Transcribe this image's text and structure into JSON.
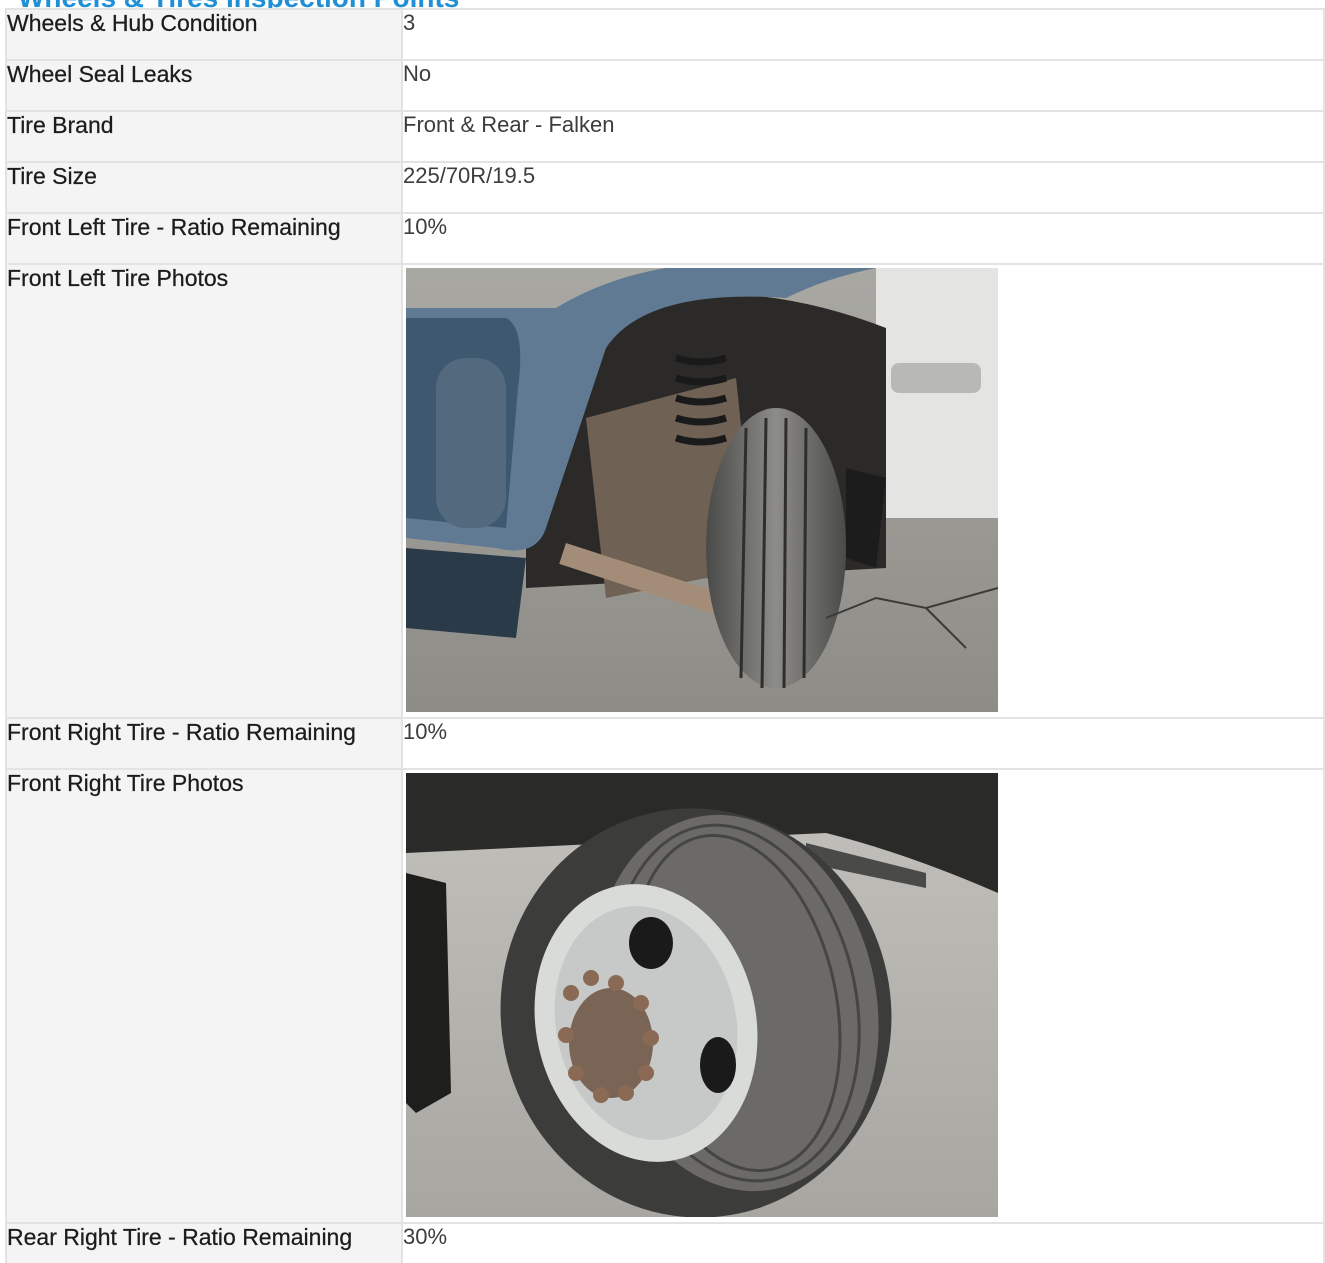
{
  "section": {
    "title": "Wheels & Tires Inspection Points"
  },
  "rows": [
    {
      "label": "Wheels & Hub Condition",
      "value": "3"
    },
    {
      "label": "Wheel Seal Leaks",
      "value": "No"
    },
    {
      "label": "Tire Brand",
      "value": "Front & Rear - Falken"
    },
    {
      "label": "Tire Size",
      "value": "225/70R/19.5"
    },
    {
      "label": "Front Left Tire - Ratio Remaining",
      "value": "10%"
    },
    {
      "label": "Front Left Tire Photos",
      "photo": "front-left-tire-photo"
    },
    {
      "label": "Front Right Tire - Ratio Remaining",
      "value": "10%"
    },
    {
      "label": "Front Right Tire Photos",
      "photo": "front-right-tire-photo"
    },
    {
      "label": "Rear Right Tire - Ratio Remaining",
      "value": "30%"
    }
  ],
  "colors": {
    "title": "#1f8fd6",
    "label_bg": "#f4f4f4",
    "border": "#e3e3e3"
  }
}
